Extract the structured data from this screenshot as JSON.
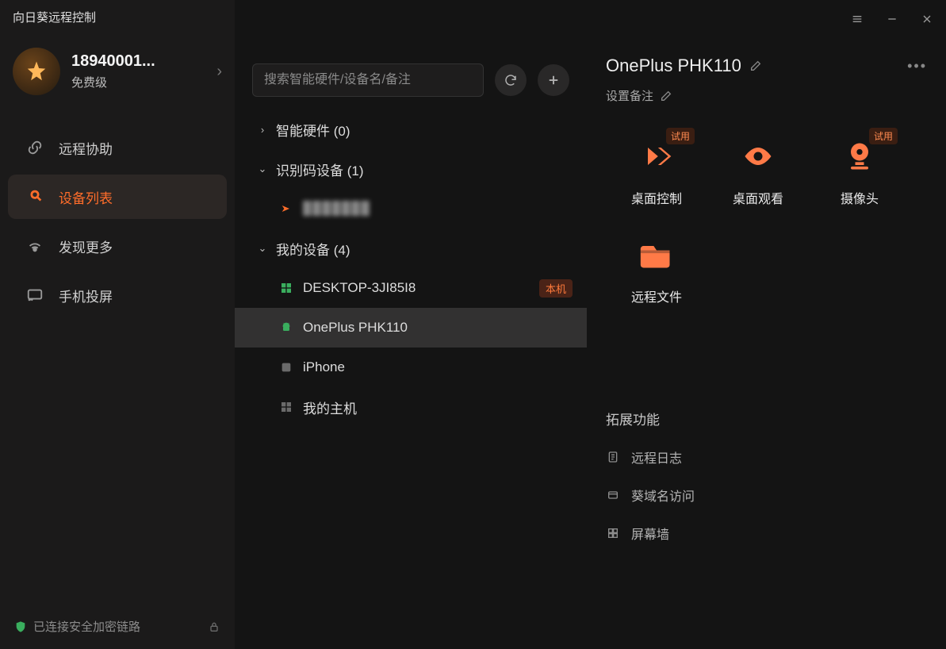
{
  "app_title": "向日葵远程控制",
  "account": {
    "id": "18940001...",
    "tier": "免费级"
  },
  "sidebar": {
    "items": [
      {
        "label": "远程协助"
      },
      {
        "label": "设备列表"
      },
      {
        "label": "发现更多"
      },
      {
        "label": "手机投屏"
      }
    ],
    "active_index": 1
  },
  "footer_status": "已连接安全加密链路",
  "search": {
    "placeholder": "搜索智能硬件/设备名/备注"
  },
  "groups": [
    {
      "label": "智能硬件",
      "count": "(0)",
      "expanded": false,
      "items": []
    },
    {
      "label": "识别码设备",
      "count": "(1)",
      "expanded": true,
      "items": [
        {
          "name": "███████",
          "icon": "sunlogin",
          "pixelated": true
        }
      ]
    },
    {
      "label": "我的设备",
      "count": "(4)",
      "expanded": true,
      "items": [
        {
          "name": "DESKTOP-3JI85I8",
          "icon": "windows",
          "badge": "本机"
        },
        {
          "name": "OnePlus PHK110",
          "icon": "android",
          "selected": true
        },
        {
          "name": "iPhone",
          "icon": "apple"
        },
        {
          "name": "我的主机",
          "icon": "windows-grey"
        }
      ]
    }
  ],
  "detail": {
    "title": "OnePlus PHK110",
    "subtitle": "设置备注",
    "actions_row1": [
      {
        "label": "桌面控制",
        "trial": "试用",
        "icon": "control"
      },
      {
        "label": "桌面观看",
        "icon": "eye"
      },
      {
        "label": "摄像头",
        "trial": "试用",
        "icon": "camera"
      }
    ],
    "actions_row2": [
      {
        "label": "远程文件",
        "icon": "folder"
      }
    ],
    "extras_title": "拓展功能",
    "extras": [
      {
        "label": "远程日志",
        "icon": "log"
      },
      {
        "label": "葵域名访问",
        "icon": "domain"
      },
      {
        "label": "屏幕墙",
        "icon": "grid"
      }
    ]
  }
}
